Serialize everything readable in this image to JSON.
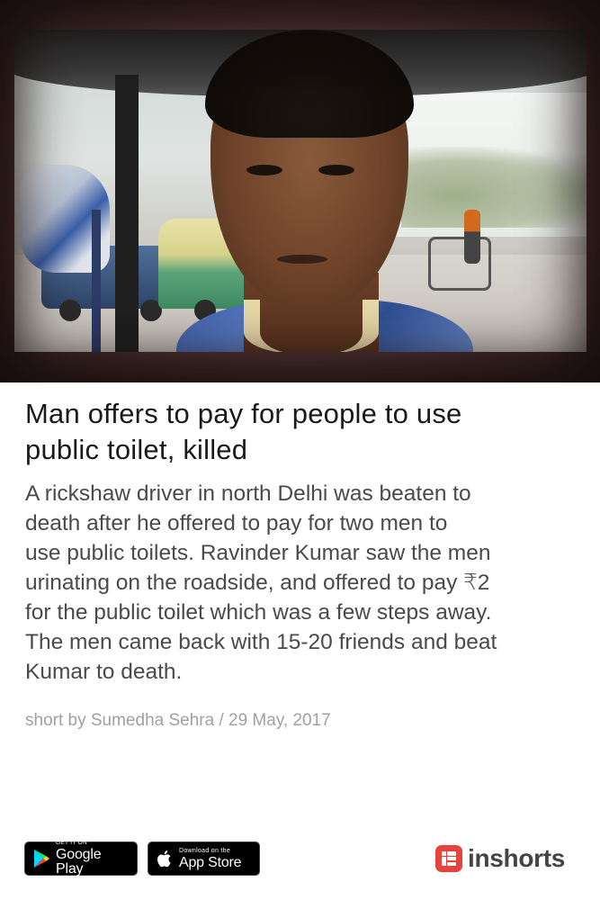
{
  "article": {
    "headline_line1": "Man offers to pay for people to use",
    "headline_line2": "public toilet, killed",
    "body_lines": [
      "A rickshaw driver in north Delhi was beaten to",
      "death after he offered to pay for two men to",
      "use public toilets. Ravinder Kumar saw the men",
      "urinating on the roadside, and offered to pay ₹2",
      "for the public toilet which was a few steps away.",
      "The men came back with 15-20 friends and beat",
      "Kumar to death."
    ],
    "byline": "short by Sumedha Sehra / 29 May, 2017"
  },
  "footer": {
    "google_play": {
      "small": "GET IT ON",
      "big": "Google Play",
      "icon": "play-triangle-icon"
    },
    "app_store": {
      "small": "Download on the",
      "big": "App Store",
      "icon": "apple-icon"
    },
    "brand": {
      "name": "inshorts",
      "color": "#e8423f",
      "icon": "inshorts-logo-icon"
    }
  }
}
